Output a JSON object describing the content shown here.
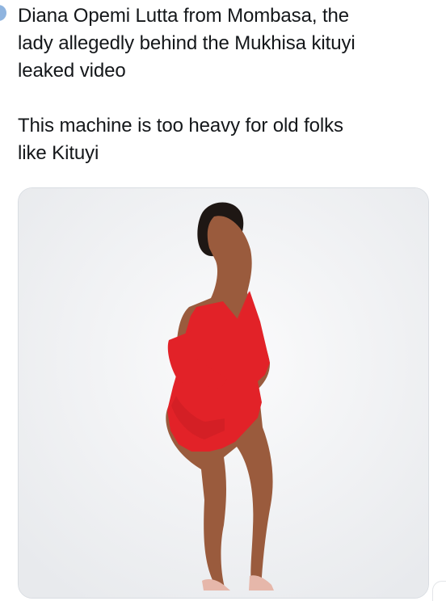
{
  "tweet": {
    "caption_line_1": "Diana Opemi Lutta from Mombasa, the\nlady allegedly behind the Mukhisa kituyi\nleaked video",
    "caption_line_2": "This machine is too heavy for old folks\nlike Kituyi"
  },
  "media": {
    "dress_color": "#e22228",
    "skin_color": "#9a5b3d",
    "shoe_color": "#e6b7aa"
  }
}
